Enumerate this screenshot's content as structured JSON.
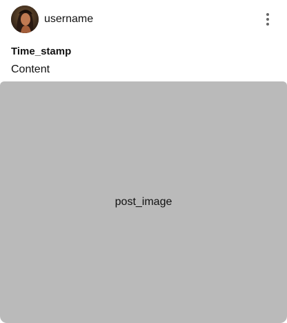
{
  "post": {
    "username": "username",
    "timestamp": "Time_stamp",
    "content": "Content",
    "image_placeholder": "post_image"
  },
  "icons": {
    "more": "more-vertical-icon",
    "avatar": "avatar"
  },
  "colors": {
    "background": "#ffffff",
    "image_placeholder": "#bababa",
    "menu_icon": "#666666",
    "text": "#111111"
  }
}
